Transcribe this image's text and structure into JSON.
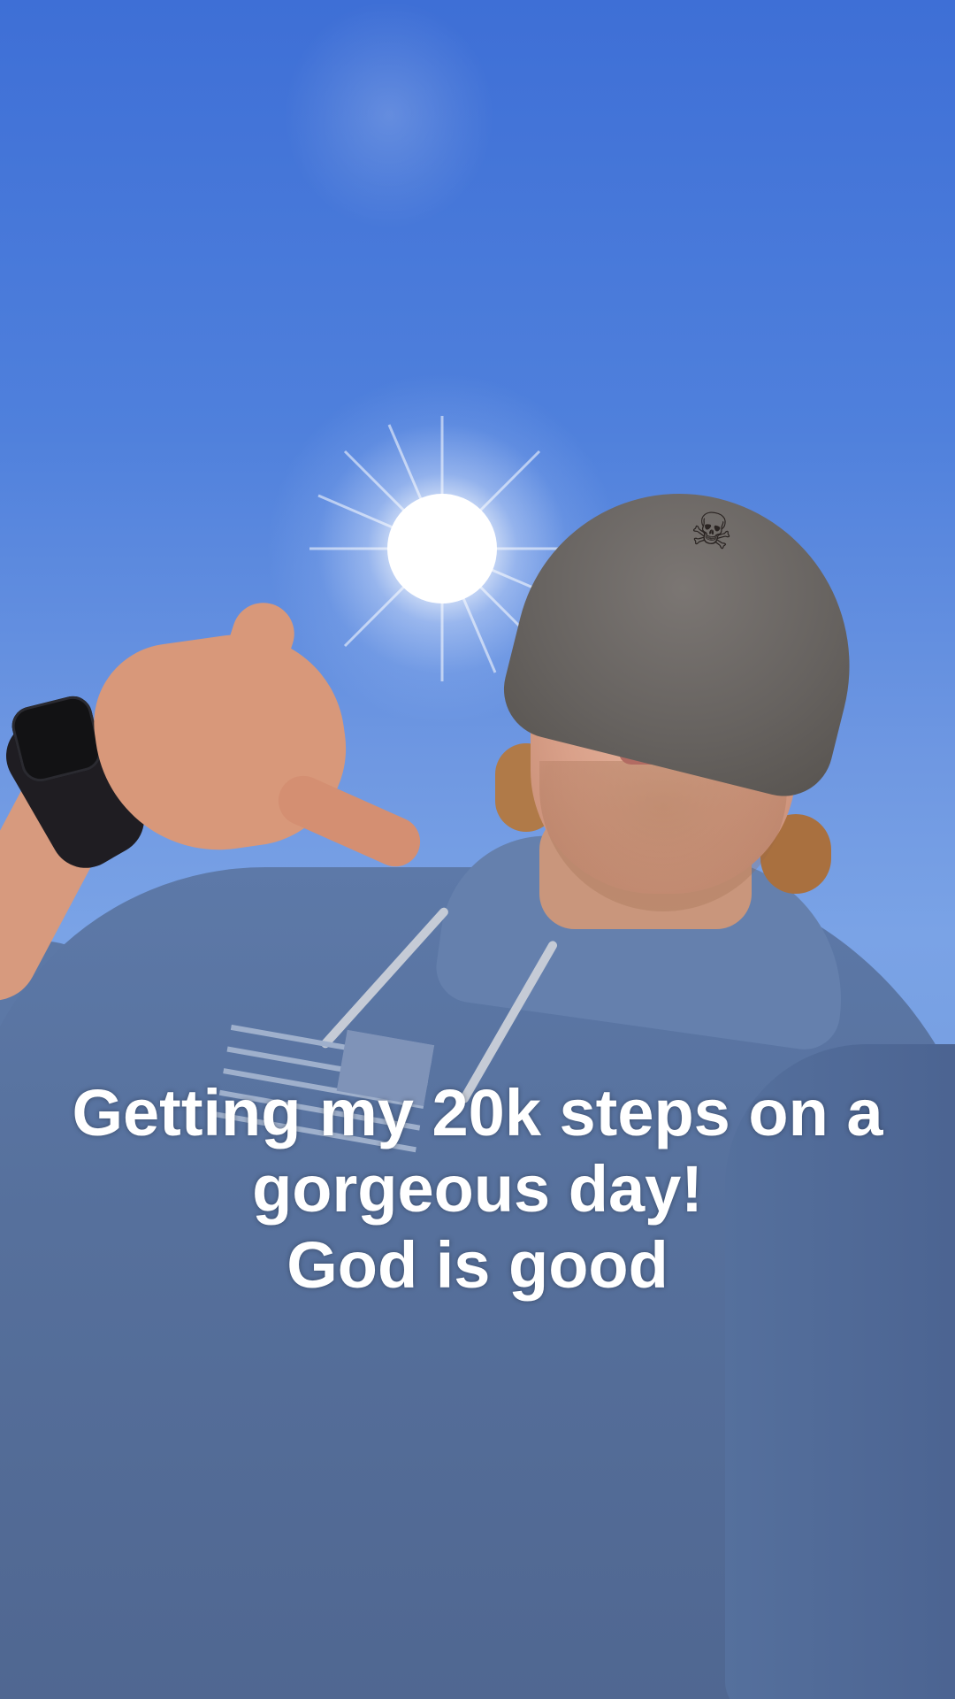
{
  "caption": {
    "line1": "Getting my 20k steps on a",
    "line2": "gorgeous day!",
    "line3": "God is good"
  },
  "colors": {
    "sky": "#4f80dc",
    "hoodie": "#56709c",
    "caption_text": "#ffffff"
  },
  "icons": {
    "beanie_logo": "mandalorian-skull-icon",
    "watch": "smartwatch-icon",
    "flag": "american-flag-icon"
  }
}
